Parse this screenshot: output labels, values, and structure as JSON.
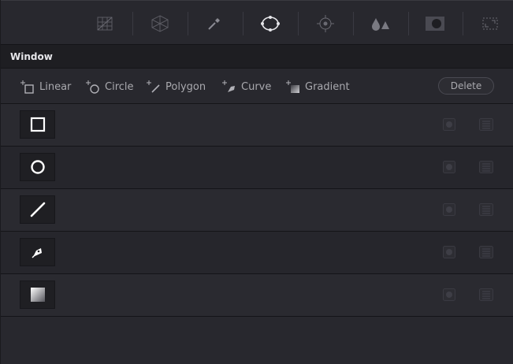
{
  "toolbar": {
    "tools": [
      {
        "icon": "curves-icon"
      },
      {
        "icon": "qualifier-icon"
      },
      {
        "icon": "eyedropper-icon"
      },
      {
        "icon": "window-icon"
      },
      {
        "icon": "tracker-icon"
      },
      {
        "icon": "blur-icon"
      },
      {
        "icon": "key-icon"
      },
      {
        "icon": "resize-icon"
      }
    ]
  },
  "panel": {
    "title": "Window"
  },
  "shapes": {
    "linear": "Linear",
    "circle": "Circle",
    "polygon": "Polygon",
    "curve": "Curve",
    "gradient": "Gradient",
    "delete": "Delete"
  },
  "windows": [
    {
      "shape": "square-icon"
    },
    {
      "shape": "circle-icon"
    },
    {
      "shape": "line-icon"
    },
    {
      "shape": "pen-icon"
    },
    {
      "shape": "gradient-icon"
    }
  ],
  "colors": {
    "background": "#28282e",
    "panel_header": "#1e1e22",
    "text": "#a9a9ae"
  }
}
